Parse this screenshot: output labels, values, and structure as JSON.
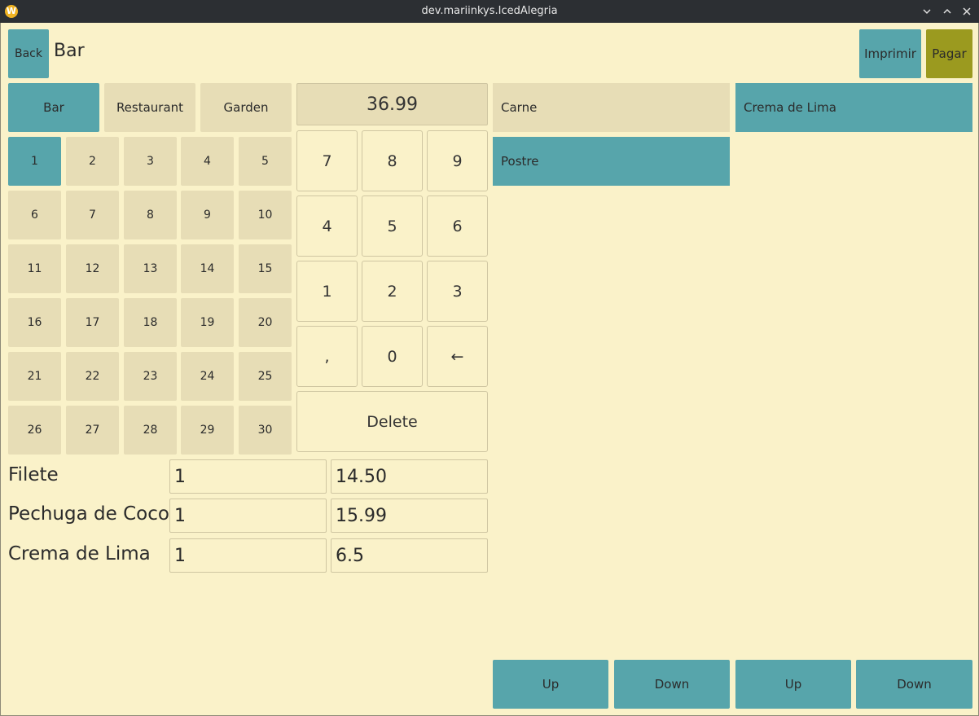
{
  "window": {
    "title": "dev.mariinkys.IcedAlegria",
    "app_icon_letter": "W"
  },
  "header": {
    "back_label": "Back",
    "title": "Bar",
    "print_label": "Imprimir",
    "pay_label": "Pagar"
  },
  "locations": [
    "Bar",
    "Restaurant",
    "Garden"
  ],
  "tables": [
    "1",
    "2",
    "3",
    "4",
    "5",
    "6",
    "7",
    "8",
    "9",
    "10",
    "11",
    "12",
    "13",
    "14",
    "15",
    "16",
    "17",
    "18",
    "19",
    "20",
    "21",
    "22",
    "23",
    "24",
    "25",
    "26",
    "27",
    "28",
    "29",
    "30"
  ],
  "selected_table": "1",
  "numpad": {
    "display": "36.99",
    "keys": [
      "7",
      "8",
      "9",
      "4",
      "5",
      "6",
      "1",
      "2",
      "3",
      ",",
      "0",
      "←"
    ],
    "delete_label": "Delete"
  },
  "order_items": [
    {
      "name": "Filete",
      "qty": "1",
      "price": "14.50"
    },
    {
      "name": "Pechuga de Coco",
      "qty": "1",
      "price": "15.99"
    },
    {
      "name": "Crema de Lima",
      "qty": "1",
      "price": "6.5"
    }
  ],
  "categories": [
    "Carne",
    "Postre"
  ],
  "products": [
    "Crema de Lima"
  ],
  "scroll": {
    "cat_up": "Up",
    "cat_down": "Down",
    "prod_up": "Up",
    "prod_down": "Down"
  },
  "colors": {
    "accent_teal": "#57a5ab",
    "inactive_beige": "#e7ddb6",
    "pay_olive": "#9b9a1f",
    "background": "#faf2c9"
  }
}
